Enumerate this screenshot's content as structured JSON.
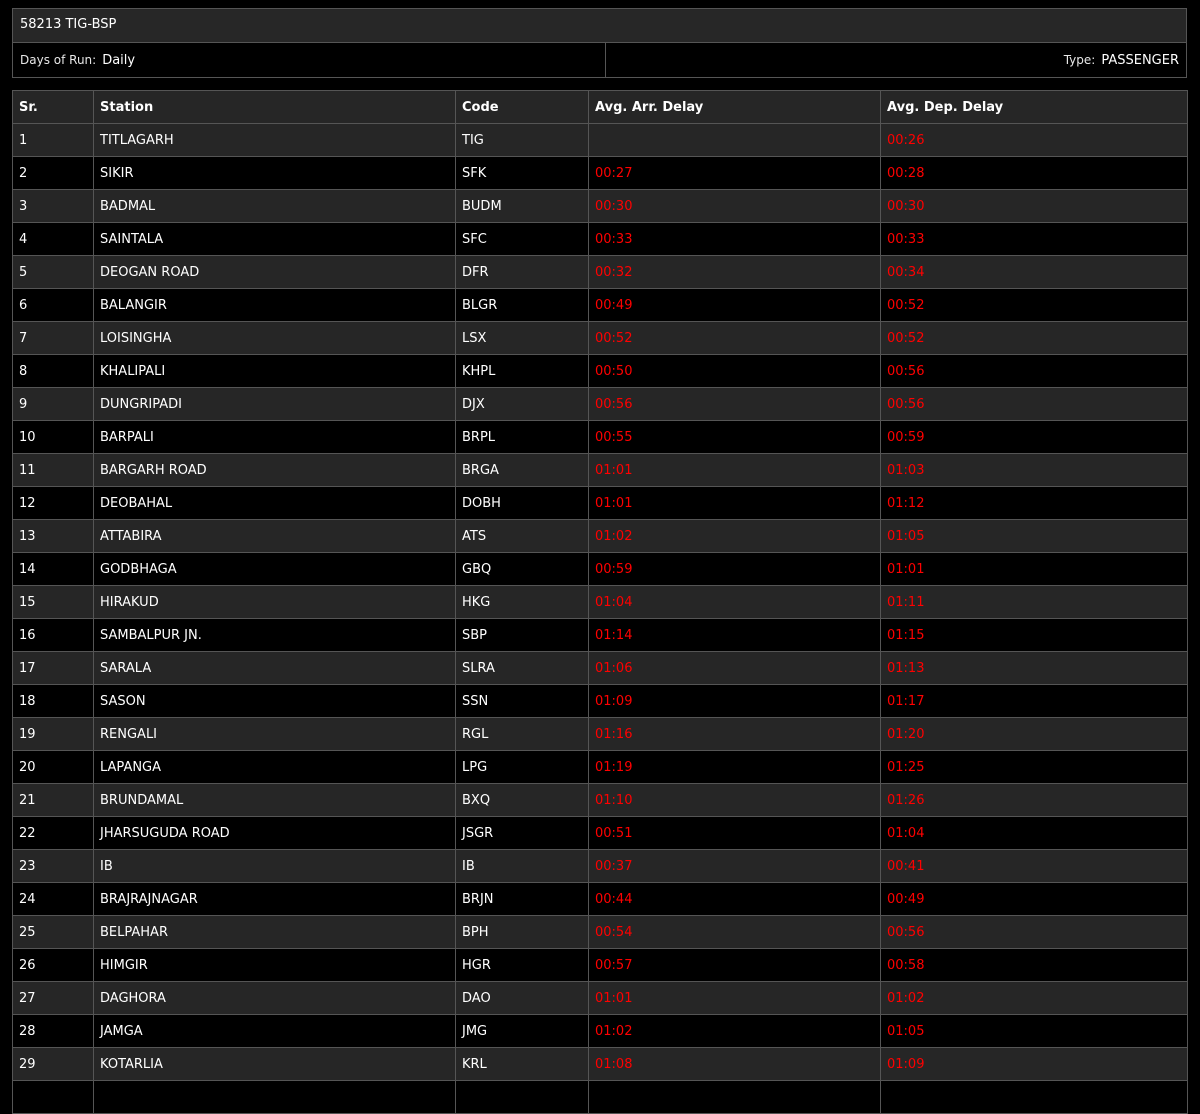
{
  "header": {
    "title": "58213 TIG-BSP",
    "days_label": "Days of Run:",
    "days_value": "Daily",
    "type_label": "Type:",
    "type_value": "PASSENGER"
  },
  "table": {
    "columns": [
      "Sr.",
      "Station",
      "Code",
      "Avg. Arr. Delay",
      "Avg. Dep. Delay"
    ],
    "rows": [
      {
        "sr": "1",
        "station": "TITLAGARH",
        "code": "TIG",
        "arr": "",
        "dep": "00:26"
      },
      {
        "sr": "2",
        "station": "SIKIR",
        "code": "SFK",
        "arr": "00:27",
        "dep": "00:28"
      },
      {
        "sr": "3",
        "station": "BADMAL",
        "code": "BUDM",
        "arr": "00:30",
        "dep": "00:30"
      },
      {
        "sr": "4",
        "station": "SAINTALA",
        "code": "SFC",
        "arr": "00:33",
        "dep": "00:33"
      },
      {
        "sr": "5",
        "station": "DEOGAN ROAD",
        "code": "DFR",
        "arr": "00:32",
        "dep": "00:34"
      },
      {
        "sr": "6",
        "station": "BALANGIR",
        "code": "BLGR",
        "arr": "00:49",
        "dep": "00:52"
      },
      {
        "sr": "7",
        "station": "LOISINGHA",
        "code": "LSX",
        "arr": "00:52",
        "dep": "00:52"
      },
      {
        "sr": "8",
        "station": "KHALIPALI",
        "code": "KHPL",
        "arr": "00:50",
        "dep": "00:56"
      },
      {
        "sr": "9",
        "station": "DUNGRIPADI",
        "code": "DJX",
        "arr": "00:56",
        "dep": "00:56"
      },
      {
        "sr": "10",
        "station": "BARPALI",
        "code": "BRPL",
        "arr": "00:55",
        "dep": "00:59"
      },
      {
        "sr": "11",
        "station": "BARGARH ROAD",
        "code": "BRGA",
        "arr": "01:01",
        "dep": "01:03"
      },
      {
        "sr": "12",
        "station": "DEOBAHAL",
        "code": "DOBH",
        "arr": "01:01",
        "dep": "01:12"
      },
      {
        "sr": "13",
        "station": "ATTABIRA",
        "code": "ATS",
        "arr": "01:02",
        "dep": "01:05"
      },
      {
        "sr": "14",
        "station": "GODBHAGA",
        "code": "GBQ",
        "arr": "00:59",
        "dep": "01:01"
      },
      {
        "sr": "15",
        "station": "HIRAKUD",
        "code": "HKG",
        "arr": "01:04",
        "dep": "01:11"
      },
      {
        "sr": "16",
        "station": "SAMBALPUR JN.",
        "code": "SBP",
        "arr": "01:14",
        "dep": "01:15"
      },
      {
        "sr": "17",
        "station": "SARALA",
        "code": "SLRA",
        "arr": "01:06",
        "dep": "01:13"
      },
      {
        "sr": "18",
        "station": "SASON",
        "code": "SSN",
        "arr": "01:09",
        "dep": "01:17"
      },
      {
        "sr": "19",
        "station": "RENGALI",
        "code": "RGL",
        "arr": "01:16",
        "dep": "01:20"
      },
      {
        "sr": "20",
        "station": "LAPANGA",
        "code": "LPG",
        "arr": "01:19",
        "dep": "01:25"
      },
      {
        "sr": "21",
        "station": "BRUNDAMAL",
        "code": "BXQ",
        "arr": "01:10",
        "dep": "01:26"
      },
      {
        "sr": "22",
        "station": "JHARSUGUDA ROAD",
        "code": "JSGR",
        "arr": "00:51",
        "dep": "01:04"
      },
      {
        "sr": "23",
        "station": "IB",
        "code": "IB",
        "arr": "00:37",
        "dep": "00:41"
      },
      {
        "sr": "24",
        "station": "BRAJRAJNAGAR",
        "code": "BRJN",
        "arr": "00:44",
        "dep": "00:49"
      },
      {
        "sr": "25",
        "station": "BELPAHAR",
        "code": "BPH",
        "arr": "00:54",
        "dep": "00:56"
      },
      {
        "sr": "26",
        "station": "HIMGIR",
        "code": "HGR",
        "arr": "00:57",
        "dep": "00:58"
      },
      {
        "sr": "27",
        "station": "DAGHORA",
        "code": "DAO",
        "arr": "01:01",
        "dep": "01:02"
      },
      {
        "sr": "28",
        "station": "JAMGA",
        "code": "JMG",
        "arr": "01:02",
        "dep": "01:05"
      },
      {
        "sr": "29",
        "station": "KOTARLIA",
        "code": "KRL",
        "arr": "01:08",
        "dep": "01:09"
      },
      {
        "sr": "",
        "station": "",
        "code": "",
        "arr": "",
        "dep": ""
      }
    ]
  },
  "colors": {
    "delay": "#ff0000",
    "row_odd": "#262626",
    "row_even": "#000000"
  }
}
